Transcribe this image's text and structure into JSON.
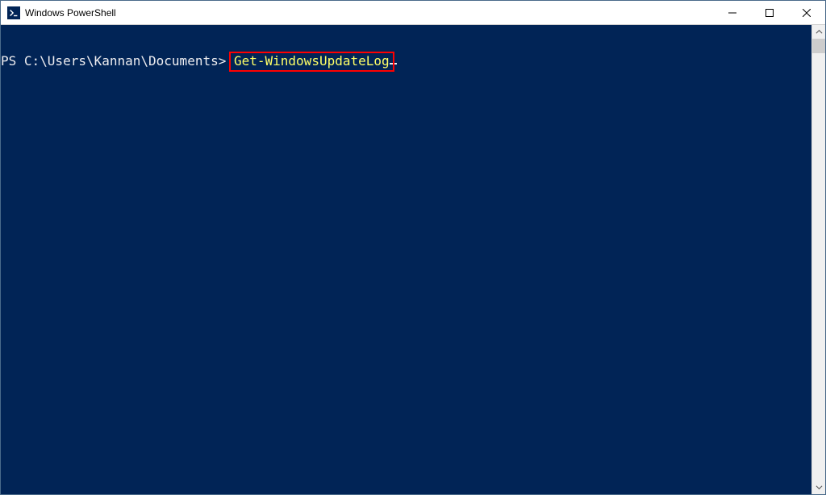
{
  "window": {
    "title": "Windows PowerShell"
  },
  "terminal": {
    "prompt": "PS C:\\Users\\Kannan\\Documents> ",
    "command": "Get-WindowsUpdateLog"
  },
  "colors": {
    "console_bg": "#012456",
    "console_fg": "#eeedf0",
    "cmd_fg": "#ffff66",
    "highlight": "#ff0000"
  }
}
